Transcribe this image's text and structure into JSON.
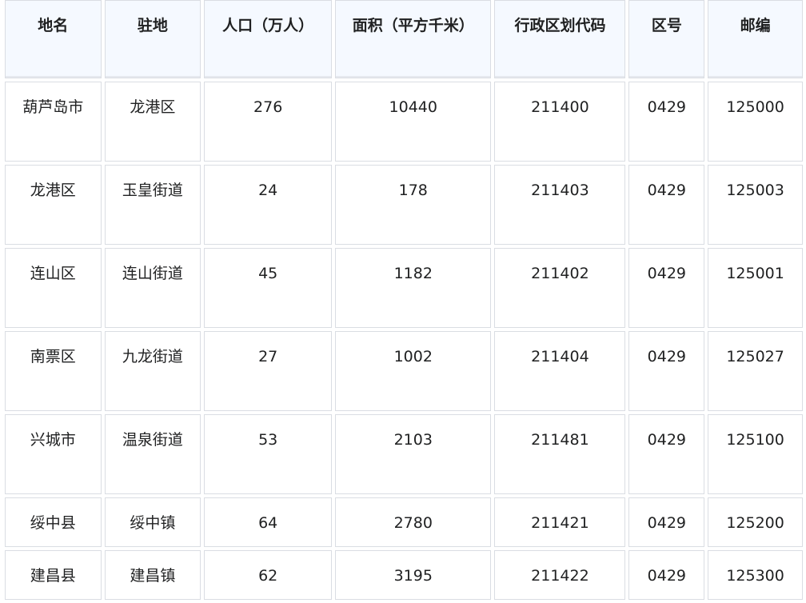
{
  "table": {
    "headers": [
      "地名",
      "驻地",
      "人口（万人）",
      "面积（平方千米）",
      "行政区划代码",
      "区号",
      "邮编"
    ],
    "rows": [
      [
        "葫芦岛市",
        "龙港区",
        "276",
        "10440",
        "211400",
        "0429",
        "125000"
      ],
      [
        "龙港区",
        "玉皇街道",
        "24",
        "178",
        "211403",
        "0429",
        "125003"
      ],
      [
        "连山区",
        "连山街道",
        "45",
        "1182",
        "211402",
        "0429",
        "125001"
      ],
      [
        "南票区",
        "九龙街道",
        "27",
        "1002",
        "211404",
        "0429",
        "125027"
      ],
      [
        "兴城市",
        "温泉街道",
        "53",
        "2103",
        "211481",
        "0429",
        "125100"
      ],
      [
        "绥中县",
        "绥中镇",
        "64",
        "2780",
        "211421",
        "0429",
        "125200"
      ],
      [
        "建昌县",
        "建昌镇",
        "62",
        "3195",
        "211422",
        "0429",
        "125300"
      ]
    ]
  }
}
